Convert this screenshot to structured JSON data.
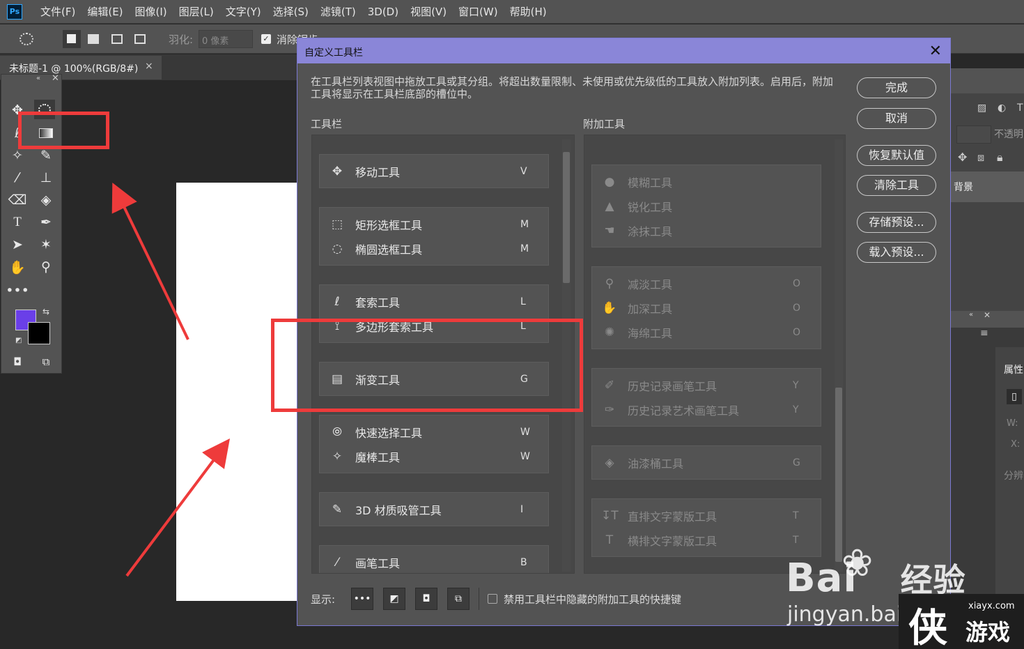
{
  "app": {
    "logo": "Ps",
    "menu": [
      "文件(F)",
      "编辑(E)",
      "图像(I)",
      "图层(L)",
      "文字(Y)",
      "选择(S)",
      "滤镜(T)",
      "3D(D)",
      "视图(V)",
      "窗口(W)",
      "帮助(H)"
    ]
  },
  "options": {
    "feather_label": "羽化:",
    "feather_value": "0 像素",
    "antialias_label": "消除锯齿"
  },
  "document": {
    "tab_title": "未标题-1 @ 100%(RGB/8#)",
    "close": "×"
  },
  "colors": {
    "foreground": "#6a3fe8",
    "background": "#000000",
    "accent_border": "#7b79d3",
    "annotation": "#ee3b3b"
  },
  "right_panel": {
    "opacity_label": "不透明",
    "layer_label": "背景",
    "properties_tab": "属性",
    "w_label": "W:",
    "x_label": "X:",
    "resolution_label": "分辨"
  },
  "dialog": {
    "title": "自定义工具栏",
    "close": "✕",
    "description": "在工具栏列表视图中拖放工具或其分组。将超出数量限制、未使用或优先级低的工具放入附加列表。启用后，附加工具将显示在工具栏底部的槽位中。",
    "toolbar_heading": "工具栏",
    "extra_heading": "附加工具",
    "buttons": {
      "done": "完成",
      "cancel": "取消",
      "restore": "恢复默认值",
      "clear": "清除工具",
      "save_preset": "存储预设...",
      "load_preset": "载入预设..."
    },
    "toolbar_groups": [
      [
        {
          "icon": "✥",
          "name": "移动工具",
          "key": "V"
        }
      ],
      [
        {
          "icon": "⬚",
          "name": "矩形选框工具",
          "key": "M"
        },
        {
          "icon": "◌",
          "name": "椭圆选框工具",
          "key": "M"
        }
      ],
      [
        {
          "icon": "ℓ",
          "name": "套索工具",
          "key": "L"
        },
        {
          "icon": "⟟",
          "name": "多边形套索工具",
          "key": "L"
        }
      ],
      [
        {
          "icon": "▤",
          "name": "渐变工具",
          "key": "G"
        }
      ],
      [
        {
          "icon": "⦾",
          "name": "快速选择工具",
          "key": "W"
        },
        {
          "icon": "✧",
          "name": "魔棒工具",
          "key": "W"
        }
      ],
      [
        {
          "icon": "✎",
          "name": "3D 材质吸管工具",
          "key": "I"
        }
      ],
      [
        {
          "icon": "⁄",
          "name": "画笔工具",
          "key": "B"
        }
      ]
    ],
    "extra_groups": [
      [
        {
          "icon": "●",
          "name": "模糊工具",
          "key": ""
        },
        {
          "icon": "▲",
          "name": "锐化工具",
          "key": ""
        },
        {
          "icon": "☚",
          "name": "涂抹工具",
          "key": ""
        }
      ],
      [
        {
          "icon": "⚲",
          "name": "减淡工具",
          "key": "O"
        },
        {
          "icon": "✋",
          "name": "加深工具",
          "key": "O"
        },
        {
          "icon": "✺",
          "name": "海绵工具",
          "key": "O"
        }
      ],
      [
        {
          "icon": "✐",
          "name": "历史记录画笔工具",
          "key": "Y"
        },
        {
          "icon": "✑",
          "name": "历史记录艺术画笔工具",
          "key": "Y"
        }
      ],
      [
        {
          "icon": "◈",
          "name": "油漆桶工具",
          "key": "G"
        }
      ],
      [
        {
          "icon": "↧T",
          "name": "直排文字蒙版工具",
          "key": "T"
        },
        {
          "icon": "T",
          "name": "横排文字蒙版工具",
          "key": "T"
        }
      ]
    ],
    "show_label": "显示:",
    "disable_shortcuts_label": "禁用工具栏中隐藏的附加工具的快捷键"
  },
  "watermark": {
    "brand": "Bai",
    "brand_paw": "du",
    "brand_suffix": "经验",
    "url": "jingyan.baidu.com",
    "site": "xiayx.com",
    "site_name": "游戏",
    "site_logo": "侠"
  }
}
